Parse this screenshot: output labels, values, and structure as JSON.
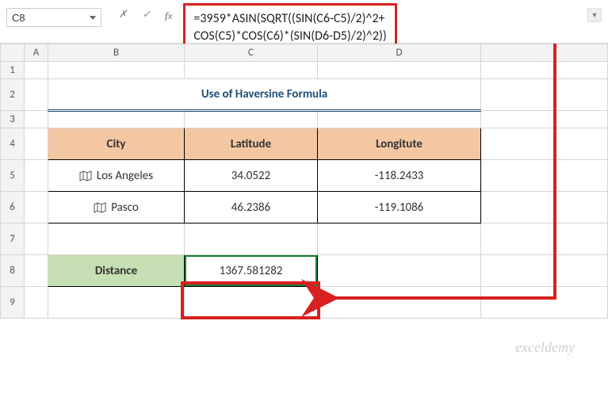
{
  "namebox": {
    "value": "C8"
  },
  "formula_lines": [
    "=3959*ASIN(SQRT((SIN(C6-C5)/2)^2+",
    "COS(C5)*COS(C6)*(SIN(D6-D5)/2)^2))"
  ],
  "fx_label": "fx",
  "columns": [
    "A",
    "B",
    "C",
    "D"
  ],
  "rows": [
    "1",
    "2",
    "3",
    "4",
    "5",
    "6",
    "7",
    "8",
    "9"
  ],
  "title": "Use of Haversine Formula",
  "headers": {
    "city": "City",
    "lat": "Latitude",
    "lon": "Longitute"
  },
  "data": [
    {
      "city": "Los Angeles",
      "lat": "34.0522",
      "lon": "-118.2433"
    },
    {
      "city": "Pasco",
      "lat": "46.2386",
      "lon": "-119.1086"
    }
  ],
  "distance": {
    "label": "Distance",
    "value": "1367.581282"
  },
  "watermark": "exceldemy",
  "icons": {
    "dropdown": "▾",
    "check": "✓",
    "x": "✗",
    "up": "▴"
  },
  "chart_data": {
    "type": "table",
    "title": "Use of Haversine Formula",
    "rows": [
      {
        "city": "Los Angeles",
        "latitude": 34.0522,
        "longitude": -118.2433
      },
      {
        "city": "Pasco",
        "latitude": 46.2386,
        "longitude": -119.1086
      }
    ],
    "computed": {
      "distance_miles": 1367.581282,
      "formula": "=3959*ASIN(SQRT((SIN(C6-C5)/2)^2+COS(C5)*COS(C6)*(SIN(D6-D5)/2)^2))"
    }
  }
}
